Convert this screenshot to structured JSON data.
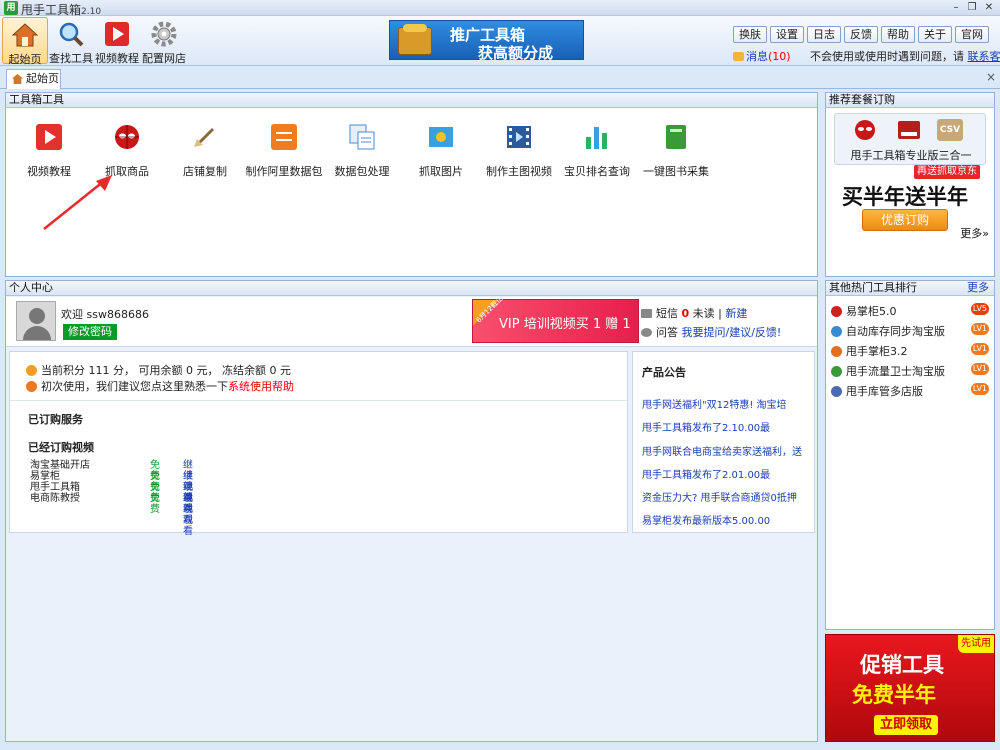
{
  "app": {
    "title": "甩手工具箱",
    "version": "2.10",
    "logo_char": "用"
  },
  "window": {
    "minimize": "–",
    "restore": "❐",
    "close": "✕"
  },
  "toolbar": {
    "buttons": [
      {
        "label": "起始页"
      },
      {
        "label": "查找工具"
      },
      {
        "label": "视频教程"
      },
      {
        "label": "配置网店"
      }
    ],
    "banner": {
      "line1": "推广工具箱",
      "line2": "获高额分成"
    },
    "top_buttons": [
      "换肤",
      "设置",
      "日志",
      "反馈",
      "帮助",
      "关于",
      "官网"
    ],
    "messages": {
      "label": "消息",
      "count": "(10)"
    },
    "help_text": "不会使用或使用时遇到问题，请",
    "help_link": "联系客服"
  },
  "tabs": {
    "home": "起始页",
    "close": "×"
  },
  "tools_panel": {
    "title": "工具箱工具",
    "tools": [
      {
        "label": "视频教程",
        "color": "#e63030"
      },
      {
        "label": "抓取商品",
        "color": "#c81818"
      },
      {
        "label": "店铺复制",
        "color": "#8a6a3a"
      },
      {
        "label": "制作阿里数据包",
        "color": "#f07c1e"
      },
      {
        "label": "数据包处理",
        "color": "#4a8ad0"
      },
      {
        "label": "抓取图片",
        "color": "#3aa0e0"
      },
      {
        "label": "制作主图视频",
        "color": "#2a5a9a"
      },
      {
        "label": "宝贝排名查询",
        "color": "#30b060"
      },
      {
        "label": "一键图书采集",
        "color": "#3a9a3a"
      }
    ]
  },
  "package_panel": {
    "title": "推荐套餐订购",
    "logos": [
      "spider",
      "tool",
      "CSV"
    ],
    "name": "甩手工具箱专业版三合一",
    "badge": "再送抓取京东",
    "headline": "买半年送半年",
    "buy_label": "优惠订购",
    "more": "更多»"
  },
  "personal": {
    "title": "个人中心",
    "welcome_prefix": "欢迎",
    "username": "ssw868686",
    "change_pwd": "修改密码",
    "vip_corner": "6月12截止",
    "vip_text": "VIP 培训视频买 1 赠 1",
    "sms": {
      "label": "短信",
      "count": "0",
      "unread": "未读",
      "sep": "|",
      "new": "新建"
    },
    "qa": {
      "label": "问答",
      "link": "我要提问/建议/反馈!"
    }
  },
  "account": {
    "points_text": "当前积分 111 分， 可用余额 0 元， 冻结余额 0 元",
    "tip_text": "初次使用，我们建议您点这里熟悉一下",
    "tip_link": "系统使用帮助",
    "services_title": "已订购服务",
    "videos_title": "已经订购视频",
    "videos": [
      {
        "name": "淘宝基础开店",
        "price": "免费",
        "action": "继续观看"
      },
      {
        "name": "易掌柜",
        "price": "免费",
        "action": "继续观看"
      },
      {
        "name": "甩手工具箱",
        "price": "免费",
        "action": "继续观看"
      },
      {
        "name": "电商陈教授",
        "price": "免费",
        "action": "继续观看"
      }
    ]
  },
  "news": {
    "title": "产品公告",
    "items": [
      "甩手网送福利\"双12特惠! 淘宝培",
      "甩手工具箱发布了2.10.00最",
      "甩手网联合电商宝给卖家送福利，送",
      "甩手工具箱发布了2.01.00最",
      "资金压力大? 甩手联合商通贷0抵押",
      "易掌柜发布最新版本5.00.00"
    ]
  },
  "ranking": {
    "title": "其他热门工具排行",
    "more": "更多",
    "items": [
      {
        "name": "易掌柜5.0",
        "level": "LV5",
        "color": "#d02020"
      },
      {
        "name": "自动库存同步淘宝版",
        "level": "LV1",
        "color": "#3a8ad0"
      },
      {
        "name": "甩手掌柜3.2",
        "level": "LV1",
        "color": "#e07020"
      },
      {
        "name": "甩手流量卫士淘宝版",
        "level": "LV1",
        "color": "#3a9a3a"
      },
      {
        "name": "甩手库管多店版",
        "level": "LV1",
        "color": "#4a6ab0"
      }
    ]
  },
  "promo": {
    "tag": "先试用",
    "line1": "促销工具",
    "line2": "免费半年",
    "button": "立即领取"
  }
}
